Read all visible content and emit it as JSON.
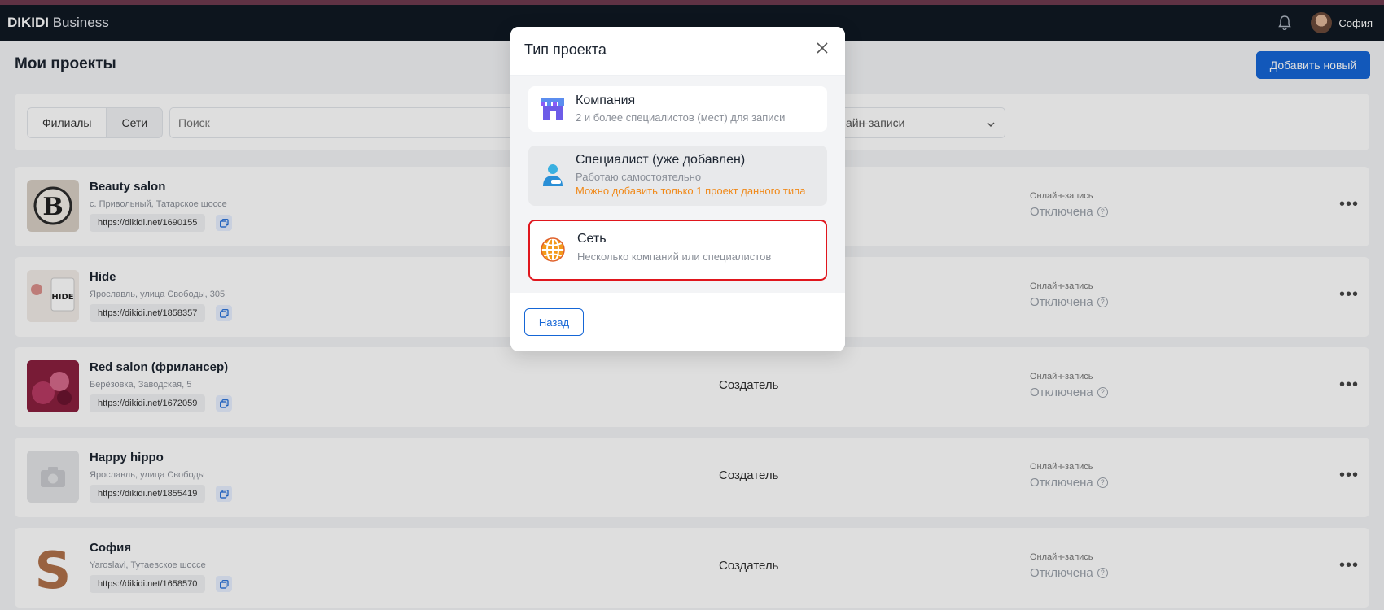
{
  "app": {
    "brand_bold": "DIKIDI",
    "brand_rest": " Business",
    "user_name": "София"
  },
  "page": {
    "title": "Мои проекты",
    "add_button": "Добавить новый"
  },
  "filters": {
    "tabs": [
      "Филиалы",
      "Сети"
    ],
    "search_placeholder": "Поиск",
    "select_value": "айн-записи"
  },
  "projects": [
    {
      "name": "Beauty salon",
      "address": "с. Привольный, Татарское шоссе",
      "link": "https://dikidi.net/1690155",
      "role": "",
      "online_label": "Онлайн-запись",
      "online_status": "Отключена"
    },
    {
      "name": "Hide",
      "address": "Ярославль, улица Свободы, 305",
      "link": "https://dikidi.net/1858357",
      "role": "",
      "online_label": "Онлайн-запись",
      "online_status": "Отключена"
    },
    {
      "name": "Red salon (фрилансер)",
      "address": "Берёзовка, Заводская, 5",
      "link": "https://dikidi.net/1672059",
      "role": "Создатель",
      "online_label": "Онлайн-запись",
      "online_status": "Отключена"
    },
    {
      "name": "Happy hippo",
      "address": "Ярославль, улица Свободы",
      "link": "https://dikidi.net/1855419",
      "role": "Создатель",
      "online_label": "Онлайн-запись",
      "online_status": "Отключена"
    },
    {
      "name": "София",
      "address": "Yaroslavl, Тутаевское шоссе",
      "link": "https://dikidi.net/1658570",
      "role": "Создатель",
      "online_label": "Онлайн-запись",
      "online_status": "Отключена"
    }
  ],
  "modal": {
    "title": "Тип проекта",
    "options": [
      {
        "title": "Компания",
        "subtitle": "2 и более специалистов (мест) для записи",
        "icon": "shop-icon"
      },
      {
        "title": "Специалист (уже добавлен)",
        "subtitle": "Работаю самостоятельно",
        "warning": "Можно добавить только 1 проект данного типа",
        "icon": "person-icon"
      },
      {
        "title": "Сеть",
        "subtitle": "Несколько компаний или специалистов",
        "icon": "globe-icon"
      }
    ],
    "back_button": "Назад"
  },
  "colors": {
    "accent": "#1566d6",
    "topbar": "#0f1923",
    "warning": "#f08a1b",
    "highlight": "#e0161d"
  }
}
